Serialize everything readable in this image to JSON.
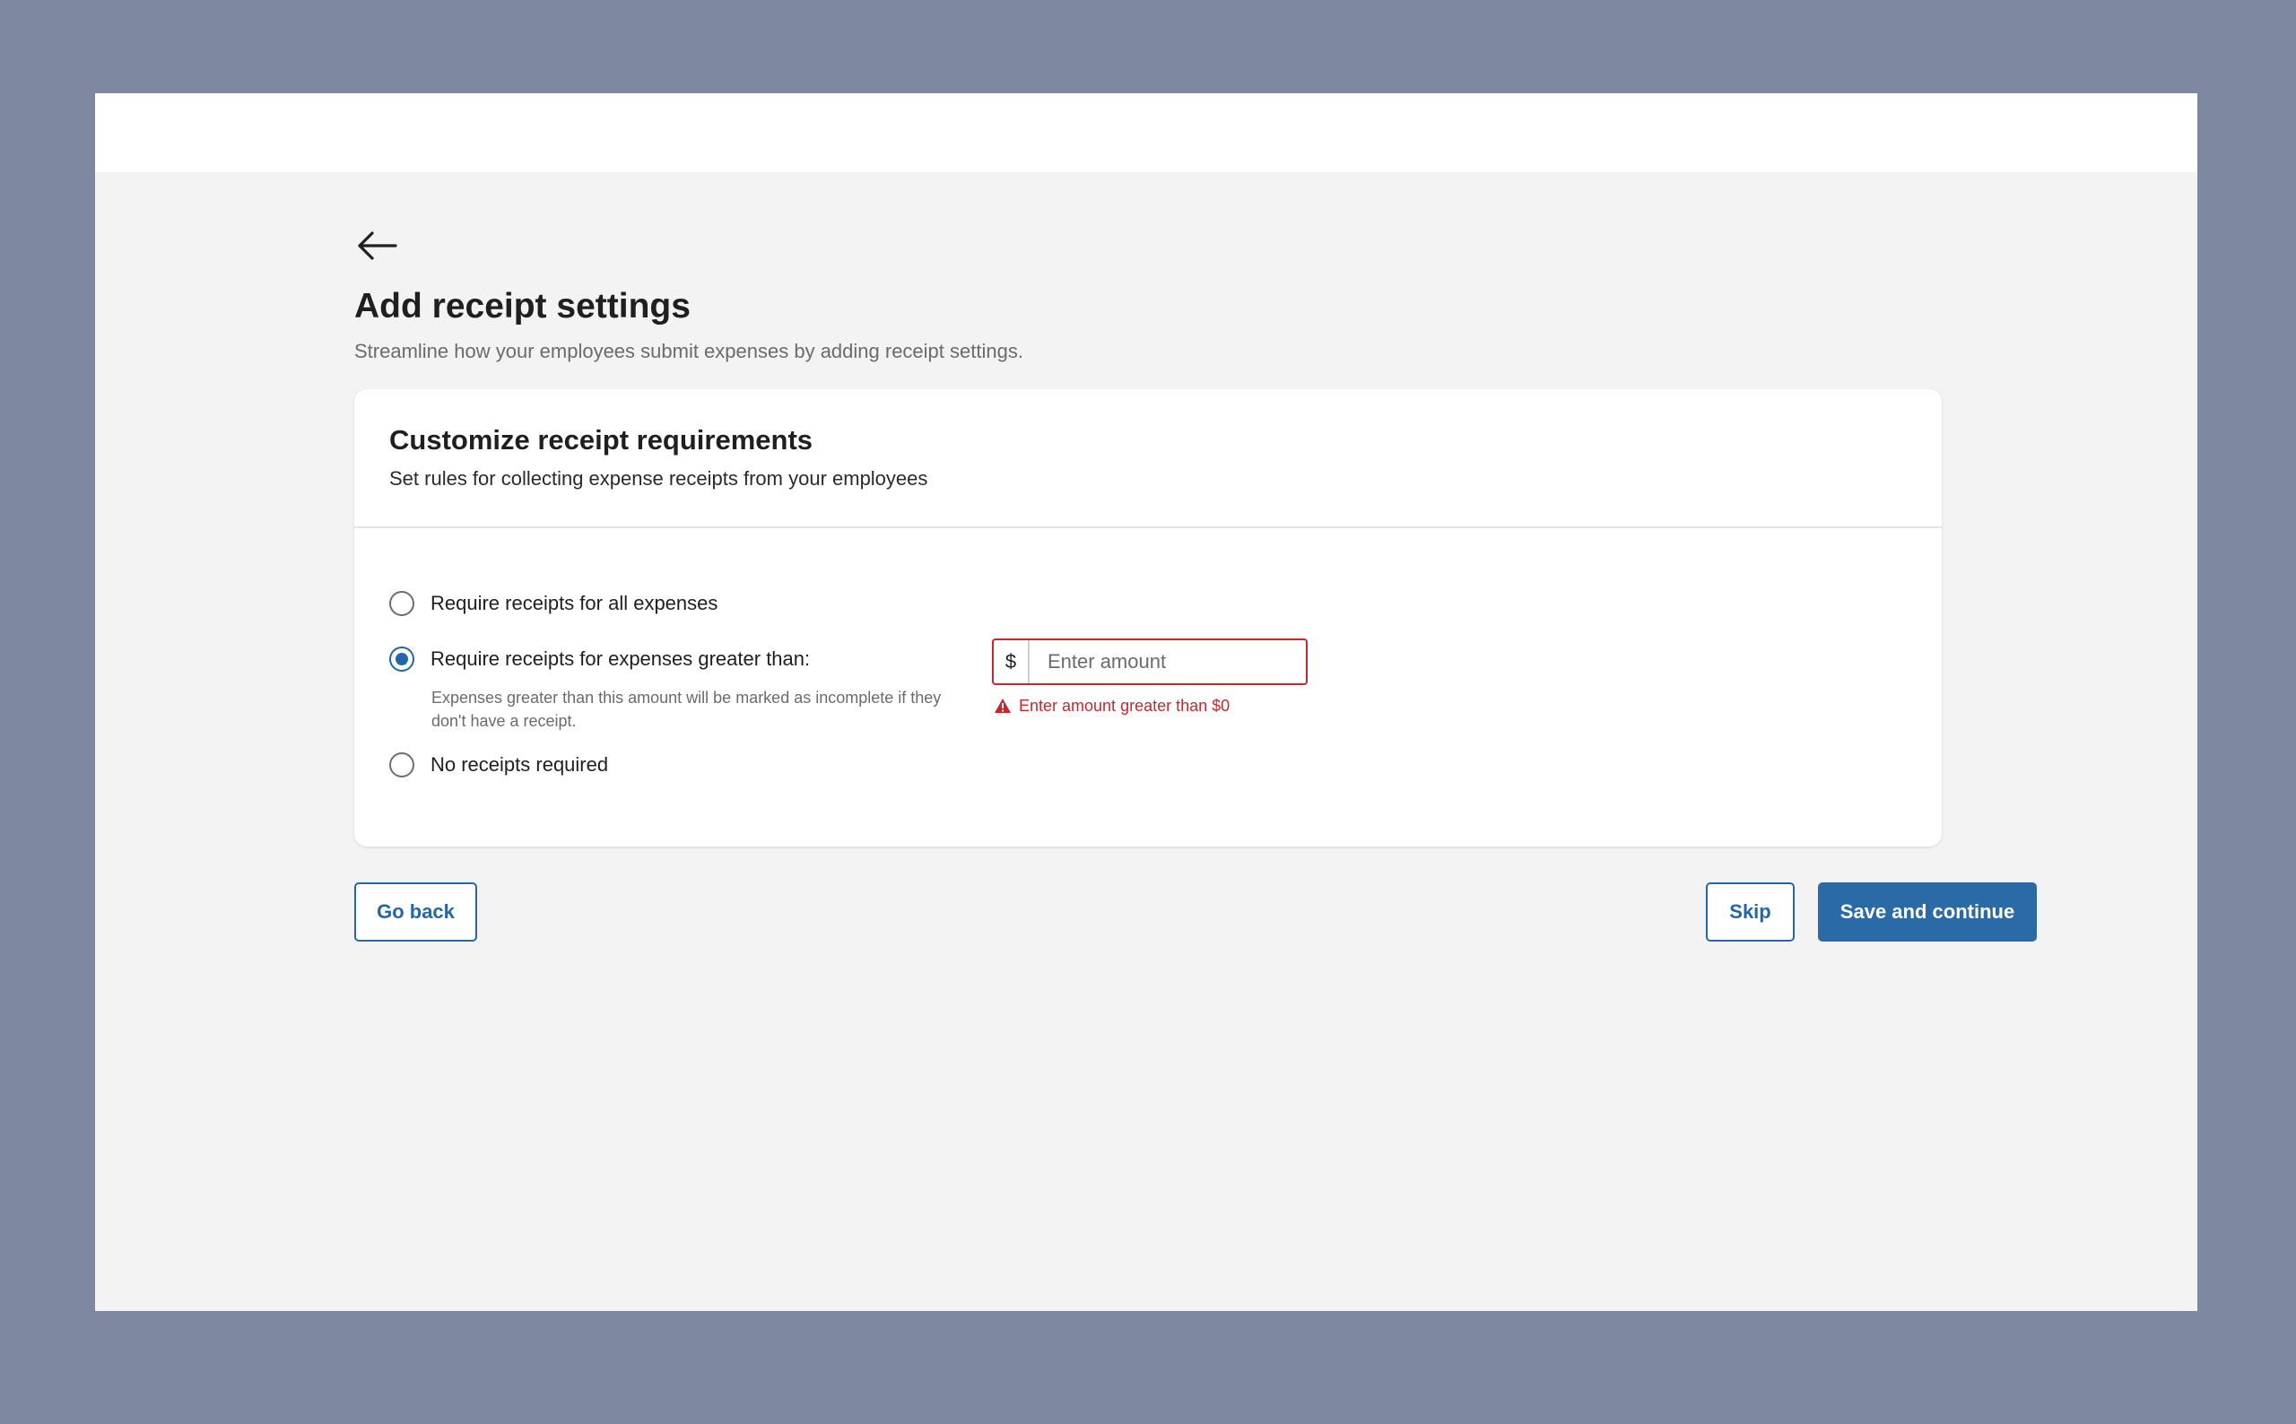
{
  "page": {
    "title": "Add receipt settings",
    "subtitle": "Streamline how your employees submit expenses by adding receipt settings."
  },
  "card": {
    "title": "Customize receipt requirements",
    "subtitle": "Set rules for collecting expense receipts from your employees"
  },
  "options": [
    {
      "label": "Require receipts for all expenses",
      "selected": false
    },
    {
      "label": "Require receipts for expenses greater than:",
      "selected": true
    },
    {
      "label": "No receipts required",
      "selected": false
    }
  ],
  "helper_text": "Expenses greater than this amount will be marked as incomplete if they don't have a receipt.",
  "amount": {
    "currency_symbol": "$",
    "placeholder": "Enter amount",
    "value": "",
    "error": "Enter amount greater than $0"
  },
  "buttons": {
    "go_back": "Go back",
    "skip": "Skip",
    "save": "Save and continue"
  },
  "colors": {
    "accent": "#2367a8",
    "error": "#c9262d",
    "backdrop": "#7e88a0"
  }
}
